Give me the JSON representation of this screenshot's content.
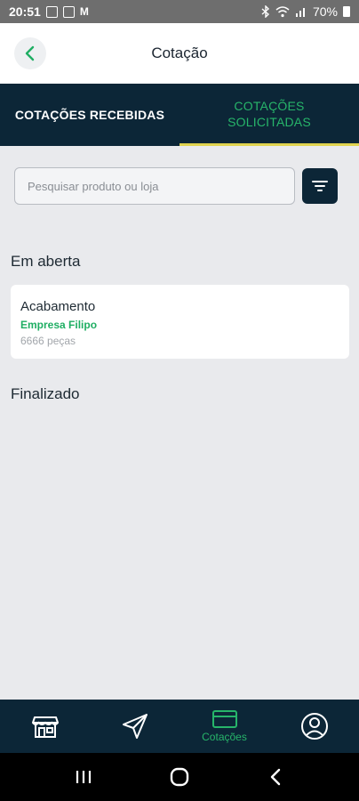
{
  "status_bar": {
    "time": "20:51",
    "icons_left": [
      "image-icon",
      "notification-icon"
    ],
    "mail_glyph": "M",
    "icons_right": [
      "bluetooth-icon",
      "wifi-icon",
      "signal-icon"
    ],
    "battery": "70%"
  },
  "header": {
    "title": "Cotação"
  },
  "tabs": [
    {
      "label": "COTAÇÕES RECEBIDAS",
      "active": false
    },
    {
      "label": "COTAÇÕES SOLICITADAS",
      "active": true
    }
  ],
  "search": {
    "placeholder": "Pesquisar produto ou loja",
    "value": ""
  },
  "sections": {
    "open_title": "Em aberta",
    "finished_title": "Finalizado"
  },
  "quotes": [
    {
      "title": "Acabamento",
      "company": "Empresa Filipo",
      "quantity": "6666 peças"
    }
  ],
  "bottom_nav": {
    "items": [
      {
        "icon": "store-icon",
        "label": ""
      },
      {
        "icon": "send-icon",
        "label": ""
      },
      {
        "icon": "card-icon",
        "label": "Cotações"
      },
      {
        "icon": "profile-icon",
        "label": ""
      }
    ],
    "active_index": 2
  },
  "colors": {
    "navy": "#0c2637",
    "accent_green": "#27b56a",
    "tab_indicator": "#e0d34f",
    "background": "#e9eaed"
  }
}
